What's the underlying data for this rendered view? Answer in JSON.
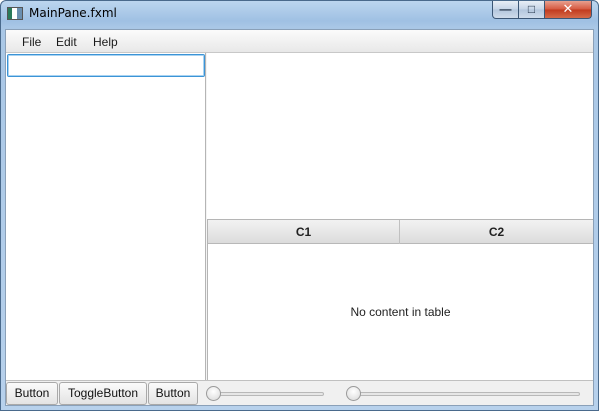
{
  "window": {
    "title": "MainPane.fxml",
    "controls": {
      "minimize": "—",
      "maximize": "□",
      "close": "✕"
    }
  },
  "menubar": {
    "items": [
      {
        "label": "File"
      },
      {
        "label": "Edit"
      },
      {
        "label": "Help"
      }
    ]
  },
  "left_pane": {
    "search": {
      "value": "",
      "placeholder": ""
    }
  },
  "table": {
    "columns": [
      {
        "label": "C1"
      },
      {
        "label": "C2"
      }
    ],
    "rows": [],
    "placeholder": "No content in table"
  },
  "bottom_bar": {
    "buttons": [
      {
        "label": "Button"
      },
      {
        "label": "ToggleButton"
      },
      {
        "label": "Button"
      }
    ],
    "sliders": [
      {
        "value": 0
      },
      {
        "value": 0
      }
    ]
  },
  "colors": {
    "focus_accent": "#3c94d6",
    "close_button": "#c13a1e"
  }
}
